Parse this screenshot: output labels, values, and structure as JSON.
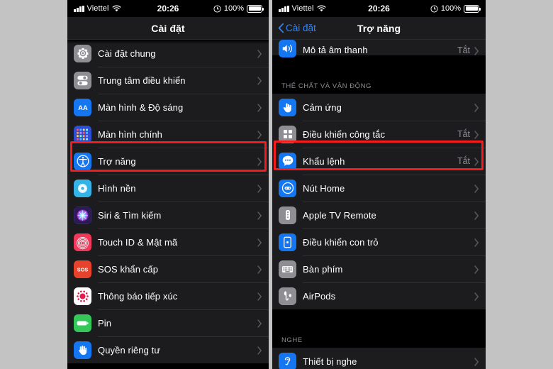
{
  "status_bar": {
    "carrier": "Viettel",
    "time": "20:26",
    "battery_percent": "100%",
    "signal_icon": "signal-bars-icon",
    "wifi_icon": "wifi-icon",
    "lock_icon": "rotation-lock-icon",
    "battery_icon": "battery-icon"
  },
  "left_phone": {
    "nav": {
      "title": "Cài đặt"
    },
    "items": [
      {
        "label": "Cài đặt chung",
        "icon": "gear-icon",
        "color": "#8e8e93",
        "value": ""
      },
      {
        "label": "Trung tâm điều khiển",
        "icon": "control-center-icon",
        "color": "#8e8e93",
        "value": ""
      },
      {
        "label": "Màn hình & Độ sáng",
        "icon": "display-brightness-icon",
        "color": "#1476f0",
        "value": ""
      },
      {
        "label": "Màn hình chính",
        "icon": "home-screen-icon",
        "color": "#2c4fd6",
        "value": ""
      },
      {
        "label": "Trợ năng",
        "icon": "accessibility-icon",
        "color": "#1476f0",
        "value": "",
        "highlighted": true
      },
      {
        "label": "Hình nền",
        "icon": "wallpaper-icon",
        "color": "#34b3e8",
        "value": ""
      },
      {
        "label": "Siri & Tìm kiếm",
        "icon": "siri-icon",
        "color": "#3b2a6b",
        "value": ""
      },
      {
        "label": "Touch ID & Mật mã",
        "icon": "fingerprint-icon",
        "color": "#f2385a",
        "value": ""
      },
      {
        "label": "SOS khẩn cấp",
        "icon": "sos-icon",
        "color": "#e8412c",
        "value": ""
      },
      {
        "label": "Thông báo tiếp xúc",
        "icon": "exposure-notification-icon",
        "color": "#ffffff",
        "value": ""
      },
      {
        "label": "Pin",
        "icon": "battery-green-icon",
        "color": "#34c759",
        "value": ""
      },
      {
        "label": "Quyền riêng tư",
        "icon": "privacy-hand-icon",
        "color": "#1476f0",
        "value": ""
      }
    ]
  },
  "right_phone": {
    "nav": {
      "back_label": "Cài đặt",
      "title": "Trợ năng",
      "back_icon": "chevron-left-icon"
    },
    "partial_item": {
      "label": "Mô tả âm thanh",
      "icon": "audio-description-icon",
      "color": "#1476f0",
      "value": "Tắt"
    },
    "sections": [
      {
        "header": "THỂ CHẤT VÀ VẬN ĐỘNG",
        "items": [
          {
            "label": "Cảm ứng",
            "icon": "touch-pointer-icon",
            "color": "#1476f0",
            "value": ""
          },
          {
            "label": "Điều khiển công tắc",
            "icon": "switch-control-icon",
            "color": "#8e8e93",
            "value": "Tắt"
          },
          {
            "label": "Khẩu lệnh",
            "icon": "voice-control-icon",
            "color": "#1476f0",
            "value": "Tắt",
            "highlighted": true
          },
          {
            "label": "Nút Home",
            "icon": "home-button-icon",
            "color": "#1476f0",
            "value": ""
          },
          {
            "label": "Apple TV Remote",
            "icon": "tv-remote-icon",
            "color": "#8e8e93",
            "value": ""
          },
          {
            "label": "Điều khiển con trỏ",
            "icon": "pointer-control-icon",
            "color": "#1476f0",
            "value": ""
          },
          {
            "label": "Bàn phím",
            "icon": "keyboard-icon",
            "color": "#8e8e93",
            "value": ""
          },
          {
            "label": "AirPods",
            "icon": "airpods-icon",
            "color": "#8e8e93",
            "value": ""
          }
        ]
      },
      {
        "header": "NGHE",
        "items": [
          {
            "label": "Thiết bị nghe",
            "icon": "hearing-devices-icon",
            "color": "#1476f0",
            "value": ""
          }
        ]
      }
    ]
  },
  "colors": {
    "highlight_box": "#f41c1c",
    "row_background": "#1c1c1e",
    "page_background": "#000000",
    "accent_blue": "#2f84f6",
    "secondary_text": "#8d8d93"
  }
}
